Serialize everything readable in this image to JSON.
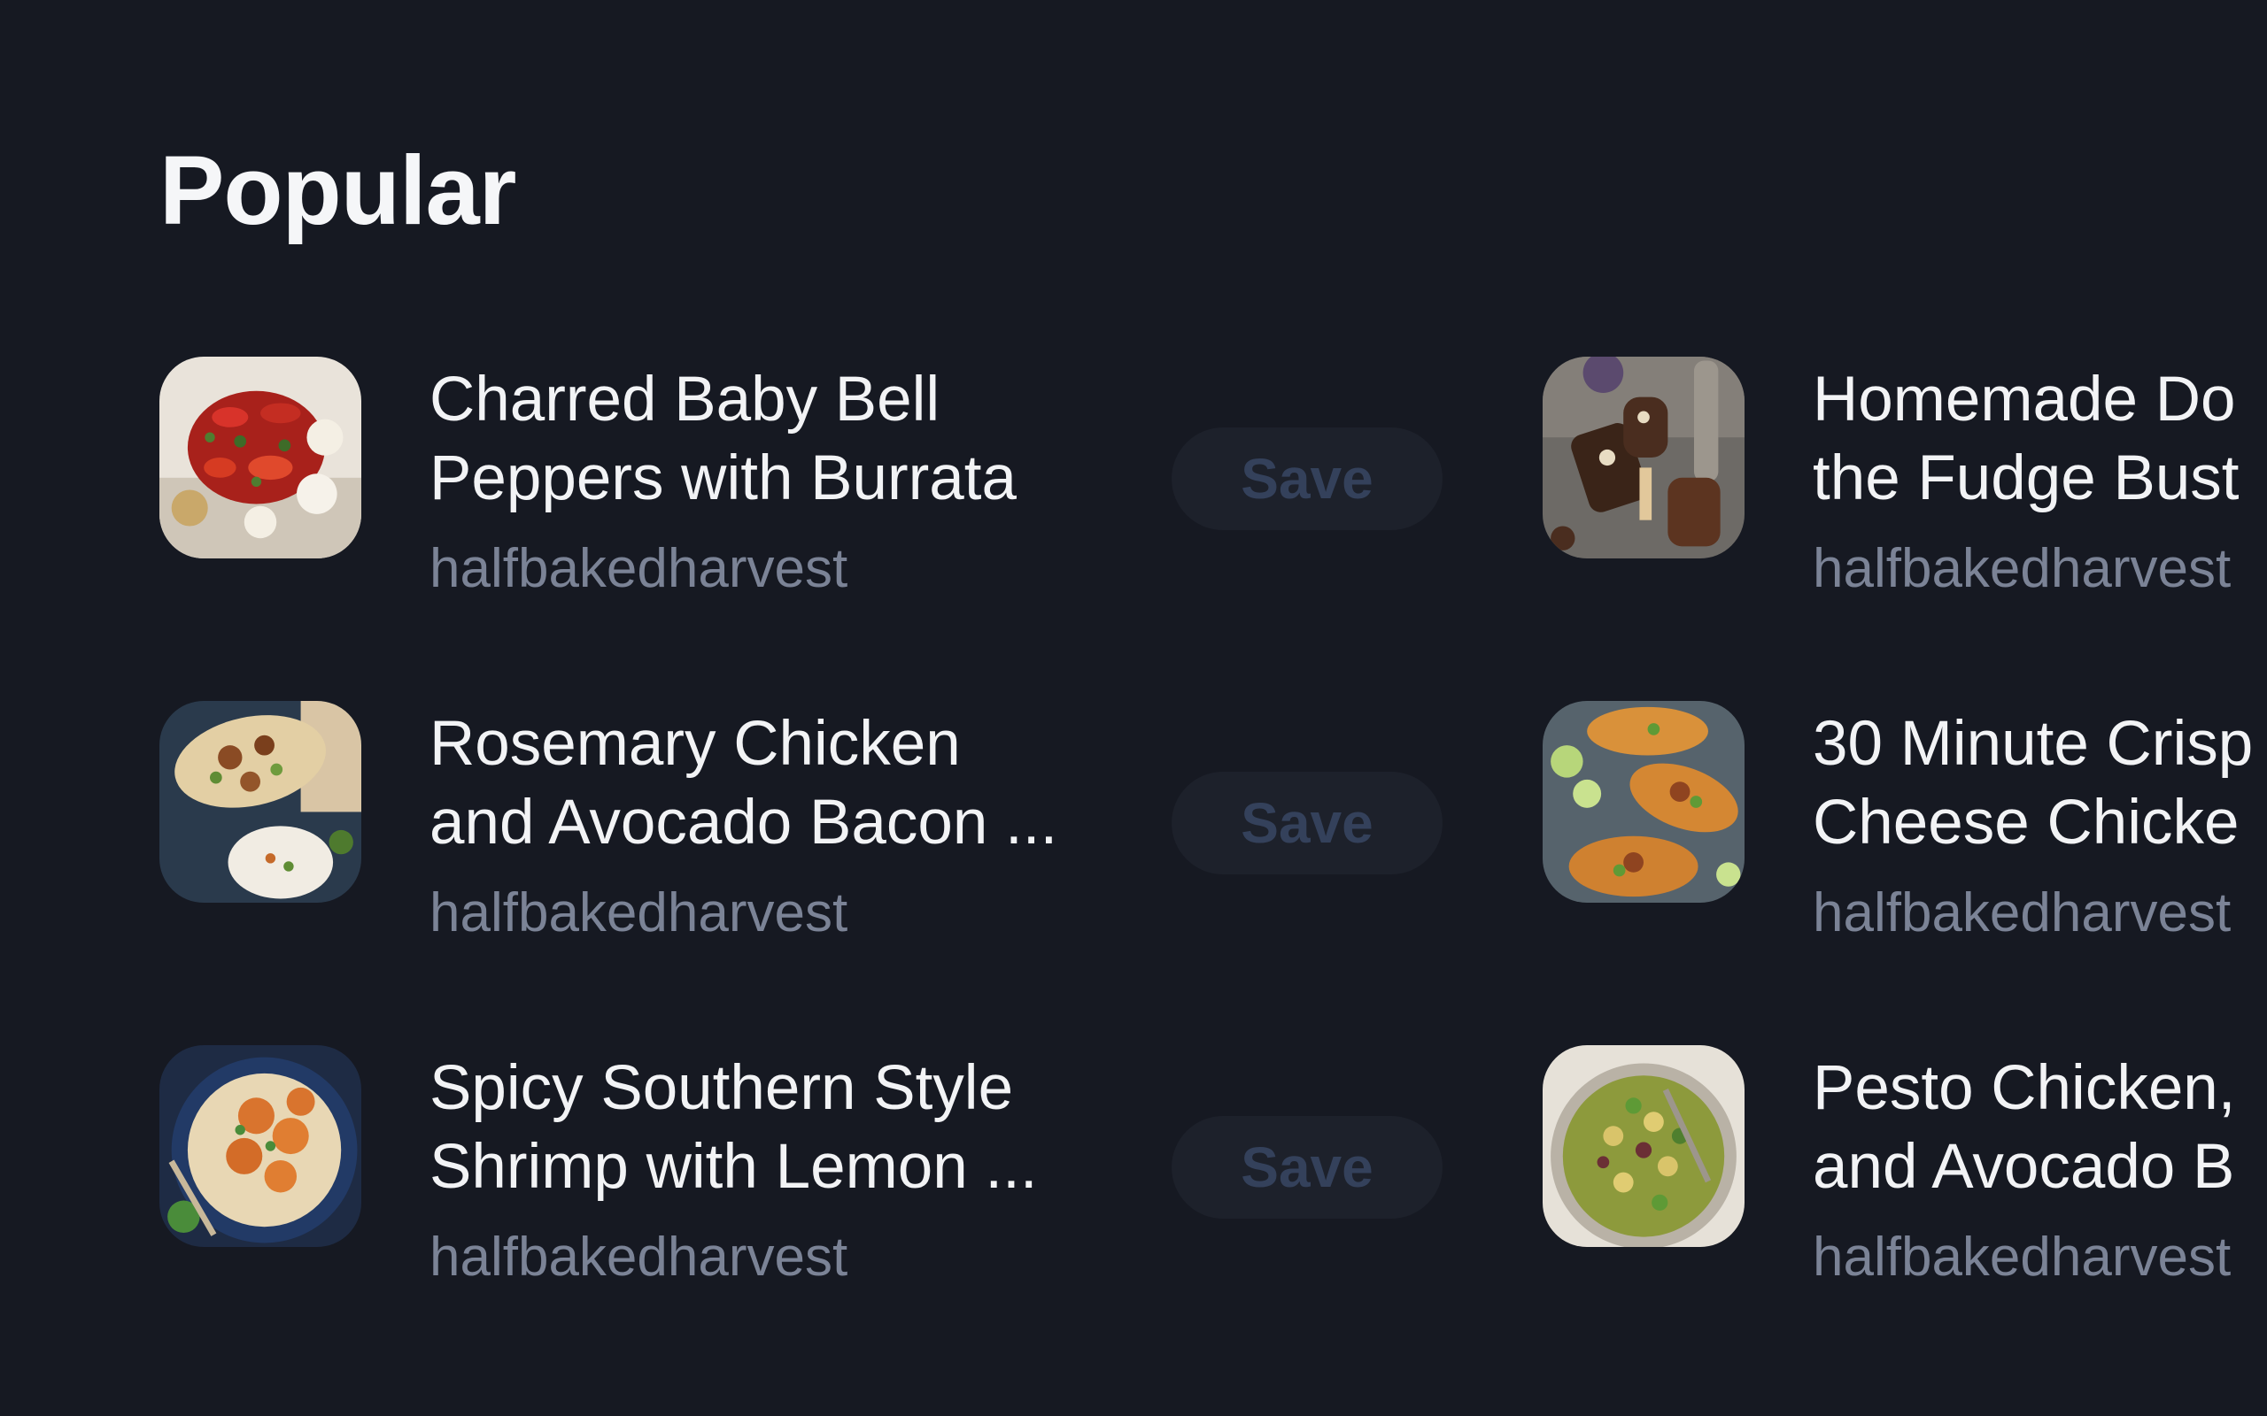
{
  "section": {
    "title": "Popular"
  },
  "colors": {
    "background": "#161922",
    "title_text": "#f2f3f5",
    "source_text": "#7b8396",
    "save_button_bg": "#1d212b",
    "save_button_text": "#34415b"
  },
  "recipes": [
    {
      "title": "Charred Baby Bell\nPeppers with Burrata",
      "source": "halfbakedharvest",
      "save_label": "Save",
      "thumbnail": "burrata-peppers-photo"
    },
    {
      "title": "Homemade Do\nthe Fudge Bust",
      "source": "halfbakedharvest",
      "thumbnail": "fudge-bars-photo"
    },
    {
      "title": "Rosemary Chicken\nand Avocado Bacon ...",
      "source": "halfbakedharvest",
      "save_label": "Save",
      "thumbnail": "chicken-wraps-photo"
    },
    {
      "title": "30 Minute Crisp\nCheese Chicke",
      "source": "halfbakedharvest",
      "thumbnail": "cheese-chicken-tacos-photo"
    },
    {
      "title": "Spicy Southern Style\nShrimp with Lemon ...",
      "source": "halfbakedharvest",
      "save_label": "Save",
      "thumbnail": "spicy-shrimp-photo"
    },
    {
      "title": "Pesto Chicken,\nand Avocado B",
      "source": "halfbakedharvest",
      "thumbnail": "pesto-pasta-salad-photo"
    }
  ]
}
